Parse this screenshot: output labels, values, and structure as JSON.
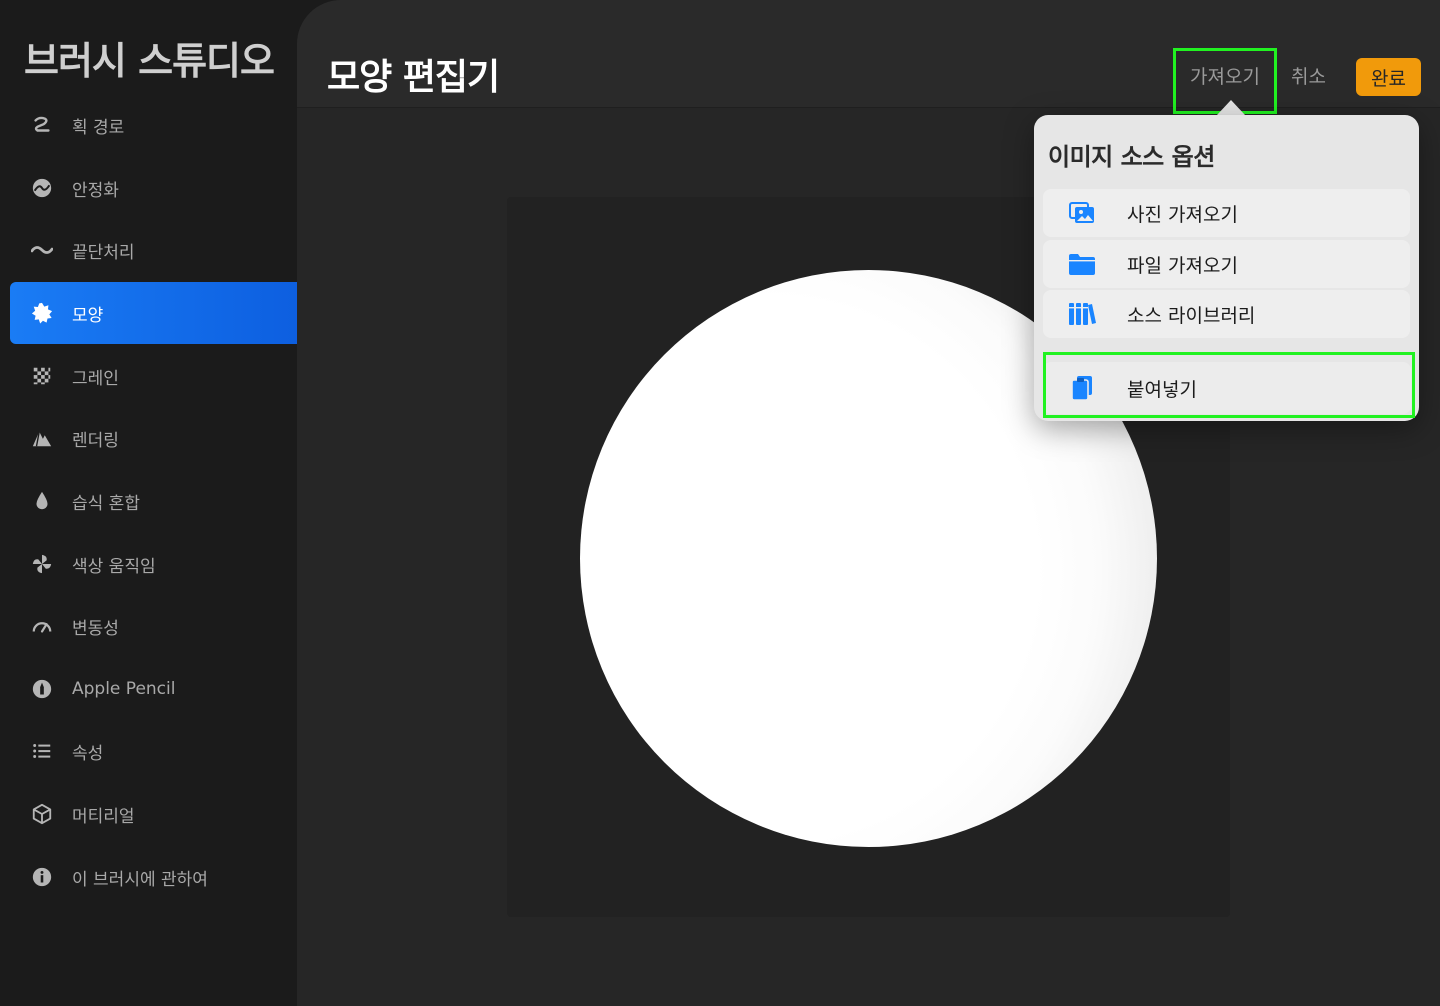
{
  "sidebar": {
    "title": "브러시 스튜디오",
    "items": [
      {
        "label": "획 경로",
        "icon": "stroke-path-icon"
      },
      {
        "label": "안정화",
        "icon": "stabilization-icon"
      },
      {
        "label": "끝단처리",
        "icon": "taper-icon"
      },
      {
        "label": "모양",
        "icon": "shape-icon",
        "active": true
      },
      {
        "label": "그레인",
        "icon": "grain-icon"
      },
      {
        "label": "렌더링",
        "icon": "rendering-icon"
      },
      {
        "label": "습식 혼합",
        "icon": "wet-mix-icon"
      },
      {
        "label": "색상 움직임",
        "icon": "color-dynamics-icon"
      },
      {
        "label": "변동성",
        "icon": "dynamics-icon"
      },
      {
        "label": "Apple Pencil",
        "icon": "apple-pencil-icon"
      },
      {
        "label": "속성",
        "icon": "properties-icon"
      },
      {
        "label": "머티리얼",
        "icon": "materials-icon"
      },
      {
        "label": "이 브러시에 관하여",
        "icon": "about-icon"
      }
    ]
  },
  "header": {
    "title": "모양 편집기",
    "import_label": "가져오기",
    "cancel_label": "취소",
    "done_label": "완료"
  },
  "popover": {
    "title": "이미지 소스 옵션",
    "items": [
      {
        "label": "사진 가져오기",
        "icon": "photo-import-icon"
      },
      {
        "label": "파일 가져오기",
        "icon": "folder-icon"
      },
      {
        "label": "소스 라이브러리",
        "icon": "library-icon"
      },
      {
        "label": "붙여넣기",
        "icon": "paste-icon"
      }
    ]
  },
  "colors": {
    "accent_blue": "#1a7cf5",
    "done_orange": "#f19a0b",
    "highlight_green": "#21f221",
    "icon_blue": "#1a85ff"
  }
}
